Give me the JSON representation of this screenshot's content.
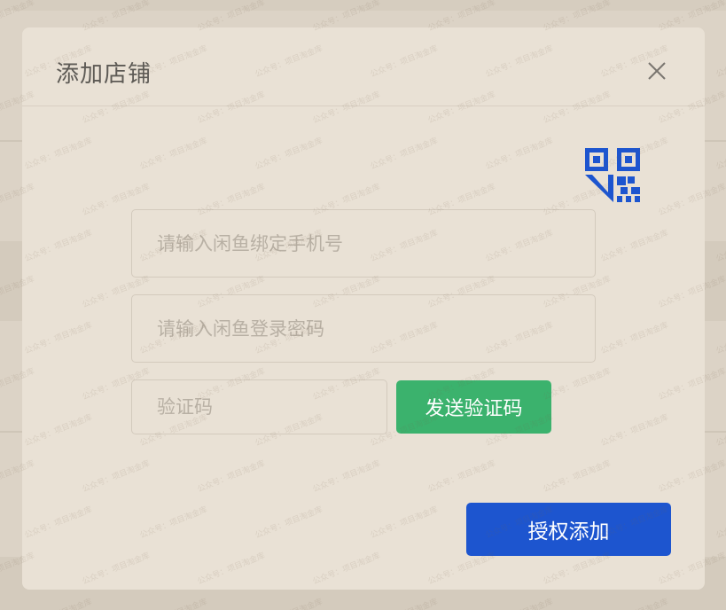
{
  "dialog": {
    "title": "添加店铺",
    "close_icon": "close-icon",
    "qr_icon": "qr-code-icon",
    "phone_placeholder": "请输入闲鱼绑定手机号",
    "password_placeholder": "请输入闲鱼登录密码",
    "code_placeholder": "验证码",
    "send_code_label": "发送验证码",
    "submit_label": "授权添加"
  },
  "watermark": "公众号：项目淘金库",
  "colors": {
    "primary": "#1d55cf",
    "success": "#3bb26d",
    "dialog_bg": "#e9e1d5",
    "overlay_bg": "#dcd3c6"
  }
}
